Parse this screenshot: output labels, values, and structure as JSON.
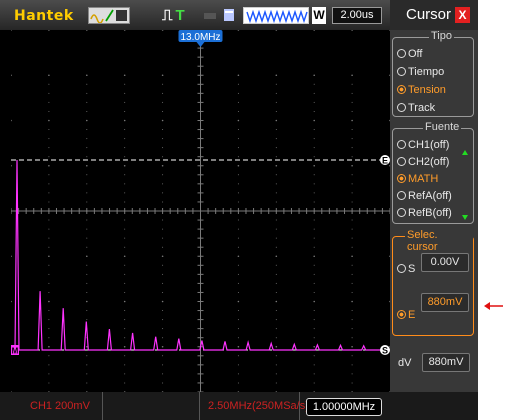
{
  "brand": "Hantek",
  "top": {
    "timebase": "2.00us",
    "window_mode": "W"
  },
  "scope": {
    "trigger_marker": "13.0MHz",
    "cursor_marker_top": "E",
    "cursor_marker_bottom": "S",
    "channel_marker": "M",
    "colors": {
      "trace": "#ff33ff",
      "cursor": "#ffffff",
      "grid": "#7a7a7a",
      "marker": "#1b6fd6"
    },
    "trace_peaks": [
      1.0,
      0.31,
      0.22,
      0.15,
      0.11,
      0.09,
      0.07,
      0.06,
      0.05,
      0.045,
      0.04,
      0.035,
      0.03,
      0.027,
      0.025,
      0.022
    ]
  },
  "panel": {
    "title": "Cursor",
    "close": "X",
    "tipo": {
      "title": "Tipo",
      "options": [
        {
          "label": "Off",
          "selected": false
        },
        {
          "label": "Tiempo",
          "selected": false
        },
        {
          "label": "Tension",
          "selected": true
        },
        {
          "label": "Track",
          "selected": false
        }
      ]
    },
    "fuente": {
      "title": "Fuente",
      "options": [
        {
          "label": "CH1(off)",
          "selected": false
        },
        {
          "label": "CH2(off)",
          "selected": false
        },
        {
          "label": "MATH",
          "selected": true
        },
        {
          "label": "RefA(off)",
          "selected": false
        },
        {
          "label": "RefB(off)",
          "selected": false
        }
      ]
    },
    "selec_cursor": {
      "title": "Selec. cursor",
      "s_label": "S",
      "s_value": "0.00V",
      "e_label": "E",
      "e_value": "880mV"
    },
    "dv_label": "dV",
    "dv_value": "880mV"
  },
  "bottom": {
    "ch1": "CH1  200mV",
    "sample": "2.50MHz(250MSa/s)",
    "frequency": "1.00000MHz"
  }
}
